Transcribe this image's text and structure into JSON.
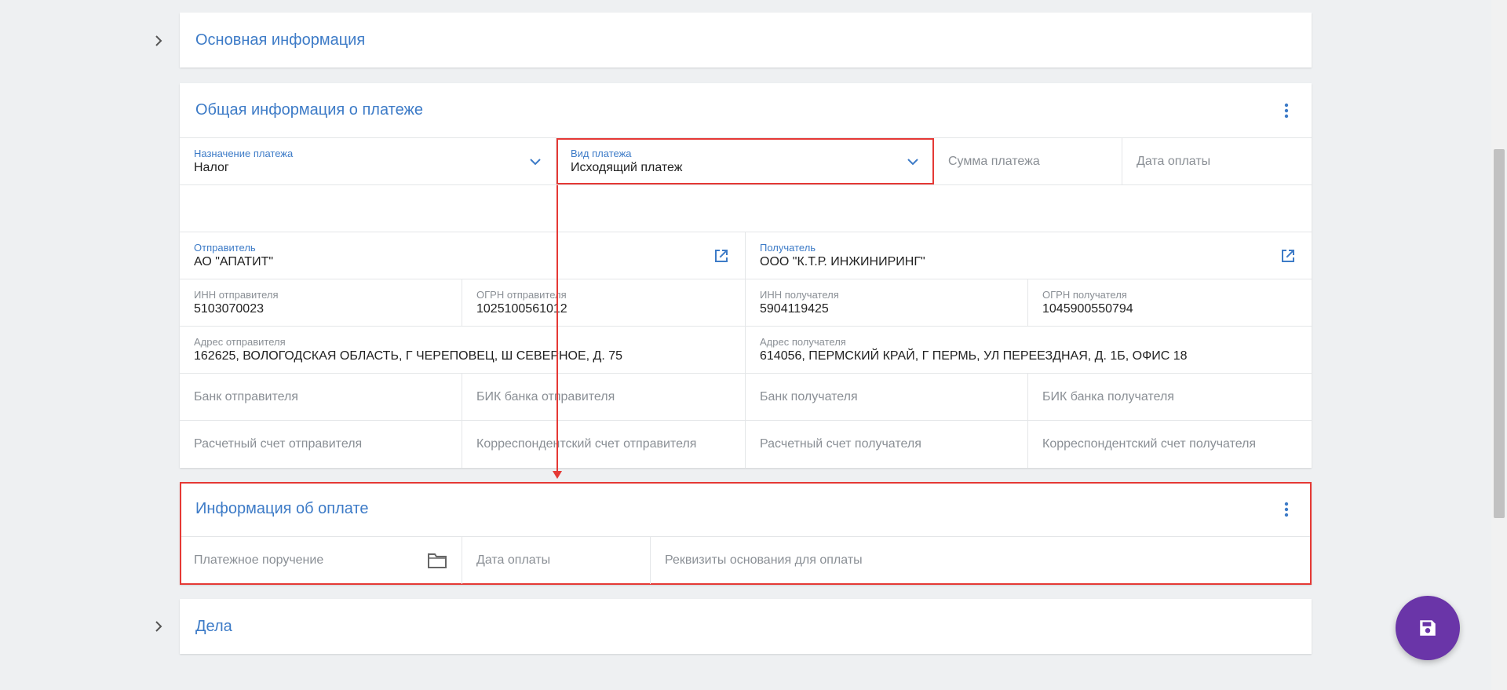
{
  "sections": {
    "basic": {
      "title": "Основная информация"
    },
    "general": {
      "title": "Общая информация о платеже",
      "purpose": {
        "label": "Назначение платежа",
        "value": "Налог"
      },
      "type": {
        "label": "Вид платежа",
        "value": "Исходящий платеж"
      },
      "amount_placeholder": "Сумма платежа",
      "pay_date_placeholder": "Дата оплаты",
      "sender": {
        "label": "Отправитель",
        "value": "АО \"АПАТИТ\""
      },
      "receiver": {
        "label": "Получатель",
        "value": "ООО \"К.Т.Р. ИНЖИНИРИНГ\""
      },
      "sender_inn": {
        "label": "ИНН отправителя",
        "value": "5103070023"
      },
      "sender_ogrn": {
        "label": "ОГРН отправителя",
        "value": "1025100561012"
      },
      "receiver_inn": {
        "label": "ИНН получателя",
        "value": "5904119425"
      },
      "receiver_ogrn": {
        "label": "ОГРН получателя",
        "value": "1045900550794"
      },
      "sender_address": {
        "label": "Адрес отправителя",
        "value": "162625, ВОЛОГОДСКАЯ ОБЛАСТЬ, Г ЧЕРЕПОВЕЦ, Ш СЕВЕРНОЕ, Д. 75"
      },
      "receiver_address": {
        "label": "Адрес получателя",
        "value": "614056, ПЕРМСКИЙ КРАЙ, Г ПЕРМЬ, УЛ ПЕРЕЕЗДНАЯ, Д. 1Б, ОФИС 18"
      },
      "sender_bank": "Банк отправителя",
      "sender_bik": "БИК банка отправителя",
      "receiver_bank": "Банк получателя",
      "receiver_bik": "БИК банка получателя",
      "sender_account": "Расчетный счет отправителя",
      "sender_corr": "Корреспондентский счет отправителя",
      "receiver_account": "Расчетный счет получателя",
      "receiver_corr": "Корреспондентский счет получателя"
    },
    "payment": {
      "title": "Информация об оплате",
      "order_placeholder": "Платежное поручение",
      "date_placeholder": "Дата оплаты",
      "basis_placeholder": "Реквизиты основания для оплаты"
    },
    "cases": {
      "title": "Дела"
    }
  },
  "icons": {
    "chevron": "chevron-right-icon",
    "dropdown": "chevron-down-icon",
    "open": "open-in-new-icon",
    "kebab": "more-vert-icon",
    "folder": "folder-icon",
    "save": "save-icon"
  },
  "colors": {
    "accent": "#3d7bc7",
    "highlight": "#e53935",
    "fab": "#6a35a8"
  }
}
